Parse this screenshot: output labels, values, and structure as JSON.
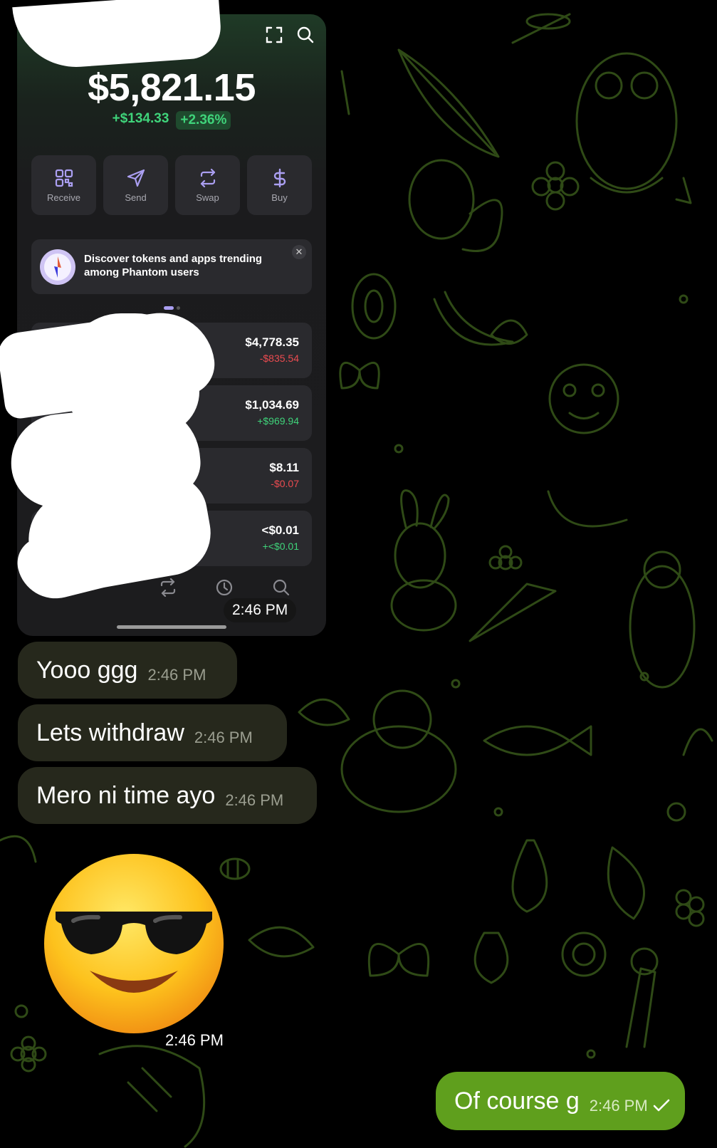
{
  "wallet": {
    "balance": "$5,821.15",
    "change_amount": "+$134.33",
    "change_percent": "+2.36%",
    "actions": [
      {
        "label": "Receive",
        "icon": "qr-code-icon"
      },
      {
        "label": "Send",
        "icon": "send-icon"
      },
      {
        "label": "Swap",
        "icon": "swap-icon"
      },
      {
        "label": "Buy",
        "icon": "dollar-icon"
      }
    ],
    "banner_text": "Discover tokens and apps trending among Phantom users",
    "close_glyph": "✕",
    "tokens": [
      {
        "value": "$4,778.35",
        "change": "-$835.54",
        "direction": "down"
      },
      {
        "value": "$1,034.69",
        "change": "+$969.94",
        "direction": "up"
      },
      {
        "value": "$8.11",
        "change": "-$0.07",
        "direction": "down"
      },
      {
        "value": "<$0.01",
        "change": "+<$0.01",
        "direction": "up"
      }
    ],
    "tabbar_icons": [
      "home-icon",
      "swap-icon",
      "history-icon",
      "search-icon"
    ]
  },
  "messages": [
    {
      "type": "image",
      "time": "2:46 PM"
    },
    {
      "type": "text",
      "text": "Yooo ggg",
      "time": "2:46 PM"
    },
    {
      "type": "text",
      "text": "Lets withdraw",
      "time": "2:46 PM"
    },
    {
      "type": "text",
      "text": "Mero ni time ayo",
      "time": "2:46 PM"
    },
    {
      "type": "sticker",
      "emoji": "😎",
      "time": "2:46 PM"
    }
  ],
  "outgoing": {
    "text": "Of course g",
    "time": "2:46 PM",
    "status": "sent"
  },
  "colors": {
    "accent_purple": "#ab9ff2",
    "positive": "#3fd37a",
    "negative": "#eb4b50",
    "incoming_bubble": "#26281c",
    "outgoing_bubble": "#5f9f1d",
    "wallpaper_line": "#2f4a16"
  }
}
